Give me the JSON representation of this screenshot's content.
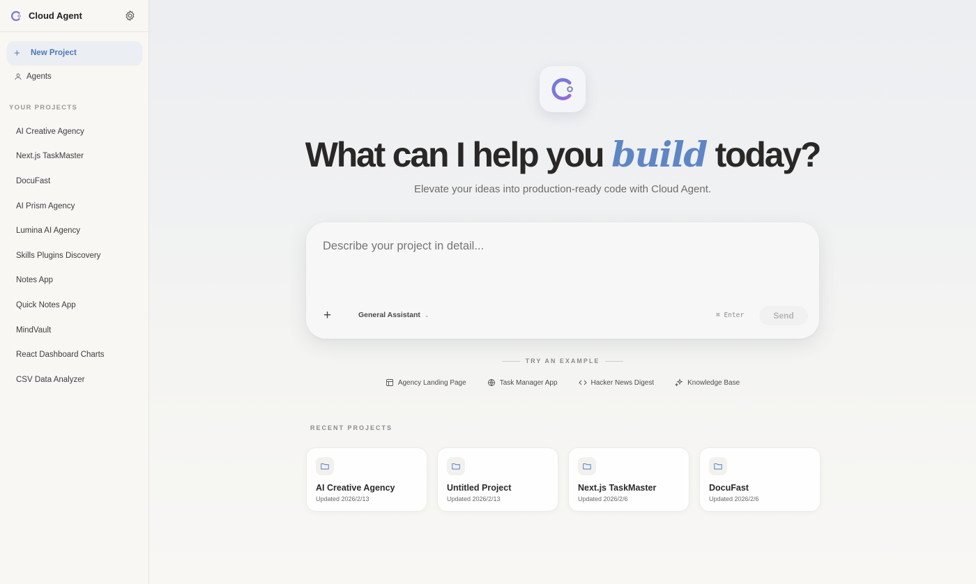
{
  "app": {
    "title": "Cloud Agent"
  },
  "sidebar": {
    "new_project_label": "New Project",
    "agents_label": "Agents",
    "projects_section_label": "YOUR PROJECTS",
    "projects": [
      "AI Creative Agency",
      "Next.js TaskMaster",
      "DocuFast",
      "AI Prism Agency",
      "Lumina AI Agency",
      "Skills Plugins Discovery",
      "Notes App",
      "Quick Notes App",
      "MindVault",
      "React Dashboard Charts",
      "CSV Data Analyzer"
    ]
  },
  "hero": {
    "headline_before": "What can I help you",
    "headline_accent": "build",
    "headline_after": "today?",
    "subtitle": "Elevate your ideas into production-ready code with Cloud Agent."
  },
  "composer": {
    "placeholder": "Describe your project in detail...",
    "agent_selector": "General Assistant",
    "shortcut_hint": "⌘ Enter",
    "send_label": "Send"
  },
  "examples": {
    "label": "TRY AN EXAMPLE",
    "items": [
      {
        "label": "Agency Landing Page",
        "icon": "layout-icon"
      },
      {
        "label": "Task Manager App",
        "icon": "globe-icon"
      },
      {
        "label": "Hacker News Digest",
        "icon": "code-icon"
      },
      {
        "label": "Knowledge Base",
        "icon": "sparkles-icon"
      }
    ]
  },
  "recent": {
    "label": "RECENT PROJECTS",
    "cards": [
      {
        "title": "AI Creative Agency",
        "updated": "Updated 2026/2/13"
      },
      {
        "title": "Untitled Project",
        "updated": "Updated 2026/2/13"
      },
      {
        "title": "Next.js TaskMaster",
        "updated": "Updated 2026/2/6"
      },
      {
        "title": "DocuFast",
        "updated": "Updated 2026/2/6"
      }
    ]
  },
  "colors": {
    "accent": "#5f86c4",
    "logo_gradient_start": "#6a7fd8",
    "logo_gradient_end": "#9a6ad8"
  }
}
